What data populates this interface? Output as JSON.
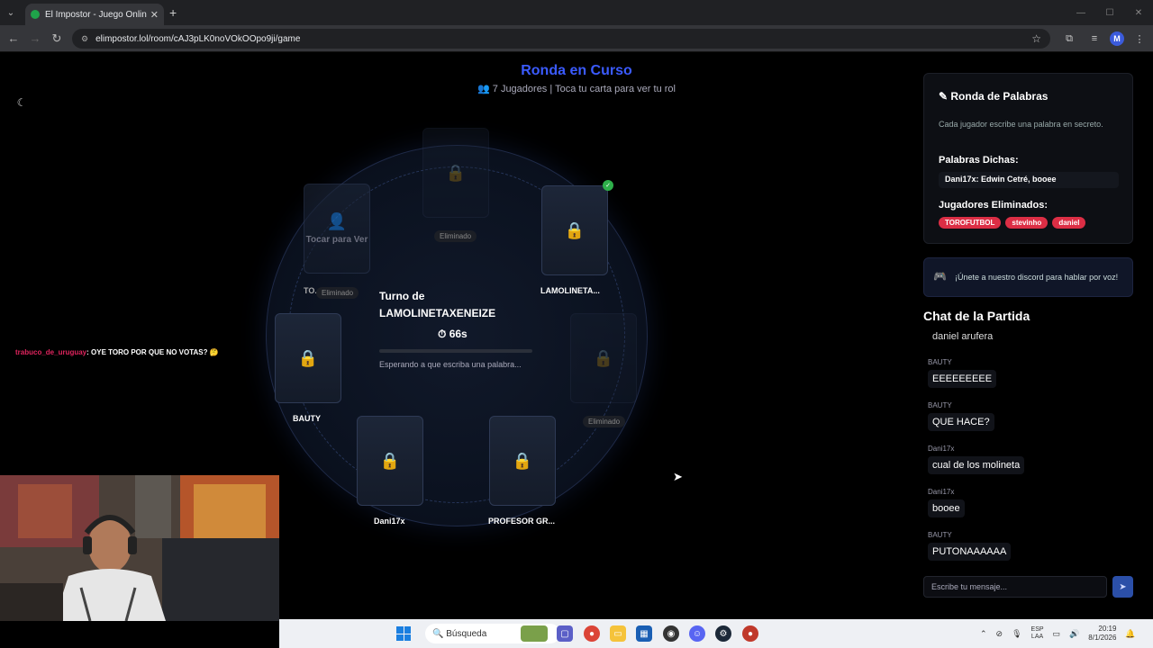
{
  "browser": {
    "tab_title": "El Impostor - Juego Online par",
    "url": "elimpostor.lol/room/cAJ3pLK0noVOkOOpo9ji/game"
  },
  "game": {
    "round_title": "Ronda en Curso",
    "subtitle": "7 Jugadores | Toca tu carta para ver tu rol",
    "turn_label": "Turno de",
    "turn_player": "LAMOLINETAXENEIZE",
    "timer": "66s",
    "timer_progress": 0.0,
    "waiting_text": "Esperando a que escriba una palabra...",
    "reveal_text": "Tocar para Ver",
    "eliminated_label": "Eliminado",
    "players": {
      "p_top": {
        "name": "",
        "eliminated": true
      },
      "p_topleft": {
        "name": "TO...",
        "eliminated": true
      },
      "p_topright": {
        "name": "LAMOLINETA...",
        "done": true
      },
      "p_left": {
        "name": "BAUTY"
      },
      "p_right": {
        "name": "",
        "eliminated": true
      },
      "p_bottomleft": {
        "name": "Dani17x"
      },
      "p_bottomright": {
        "name": "PROFESOR GR..."
      }
    }
  },
  "stream_chat": {
    "user": "trabuco_de_uruguay",
    "message": ": OYE TORO POR QUE NO VOTAS? 🤔"
  },
  "sidebar": {
    "words_title": "Ronda de Palabras",
    "words_desc": "Cada jugador escribe una palabra en secreto.",
    "said_title": "Palabras Dichas:",
    "said_entry_user": "Dani17x:",
    "said_entry_words": "Edwin Cetré, booee",
    "eliminated_title": "Jugadores Eliminados:",
    "eliminated": [
      "TOROFUTBOL",
      "stevinho",
      "daniel"
    ],
    "discord_text": "¡Únete a nuestro discord para hablar por voz!",
    "chat_title": "Chat de la Partida",
    "chat_partial": "daniel arufera",
    "chat": [
      {
        "user": "BAUTY",
        "text": "EEEEEEEEE"
      },
      {
        "user": "BAUTY",
        "text": "QUE HACE?"
      },
      {
        "user": "Dani17x",
        "text": "cual de los molineta"
      },
      {
        "user": "Dani17x",
        "text": "booee"
      },
      {
        "user": "BAUTY",
        "text": "PUTONAAAAAA"
      }
    ],
    "chat_placeholder": "Escribe tu mensaje..."
  },
  "taskbar": {
    "search_label": "Búsqueda",
    "lang_1": "ESP",
    "lang_2": "LAA",
    "time": "20:19",
    "date": "8/1/2026"
  },
  "colors": {
    "accent": "#3b5bff",
    "eliminated_badge": "#dc2e45",
    "done_check": "#2eaf4a"
  }
}
